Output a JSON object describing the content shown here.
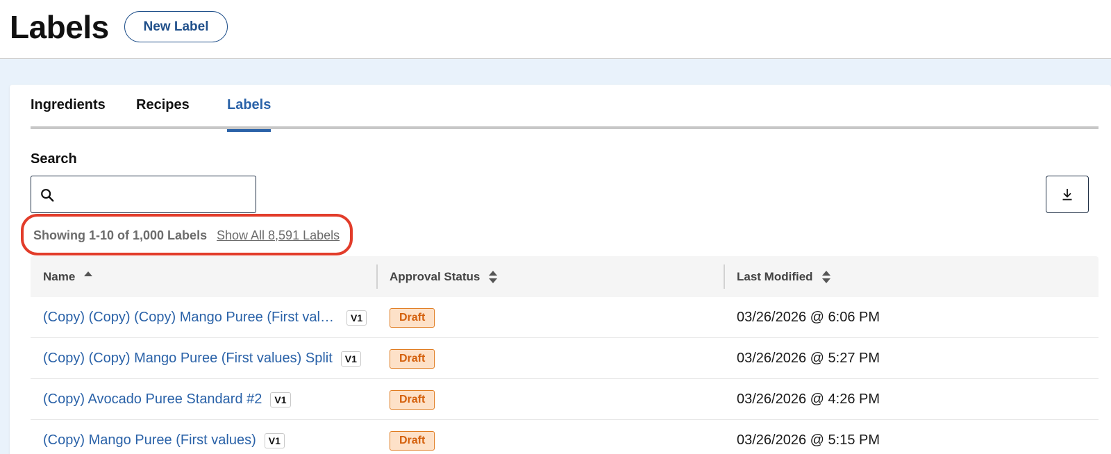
{
  "header": {
    "title": "Labels",
    "new_label_button": "New Label"
  },
  "tabs": [
    {
      "label": "Ingredients",
      "active": false
    },
    {
      "label": "Recipes",
      "active": false
    },
    {
      "label": "Labels",
      "active": true
    }
  ],
  "search": {
    "label": "Search",
    "value": "",
    "placeholder": ""
  },
  "results": {
    "showing_text": "Showing 1-10 of 1,000 Labels",
    "show_all_link": "Show All 8,591 Labels"
  },
  "table": {
    "columns": [
      "Name",
      "Approval Status",
      "Last Modified"
    ],
    "rows": [
      {
        "name": "(Copy) (Copy) (Copy) Mango Puree (First values…",
        "version": "V1",
        "status": "Draft",
        "modified": "03/26/2026 @ 6:06 PM"
      },
      {
        "name": "(Copy) (Copy) Mango Puree (First values) Split",
        "version": "V1",
        "status": "Draft",
        "modified": "03/26/2026 @ 5:27 PM"
      },
      {
        "name": "(Copy) Avocado Puree Standard #2",
        "version": "V1",
        "status": "Draft",
        "modified": "03/26/2026 @ 4:26 PM"
      },
      {
        "name": "(Copy) Mango Puree (First values)",
        "version": "V1",
        "status": "Draft",
        "modified": "03/26/2026 @ 5:15 PM"
      }
    ]
  },
  "colors": {
    "accent": "#2a62a8",
    "highlight_outline": "#e23c2a",
    "draft_badge_bg": "#fde1c8",
    "draft_badge_text": "#d4600c"
  },
  "icons": {
    "search": "search-icon",
    "download": "download-icon",
    "sort_asc": "sort-ascending-icon",
    "sort": "sort-icon"
  }
}
